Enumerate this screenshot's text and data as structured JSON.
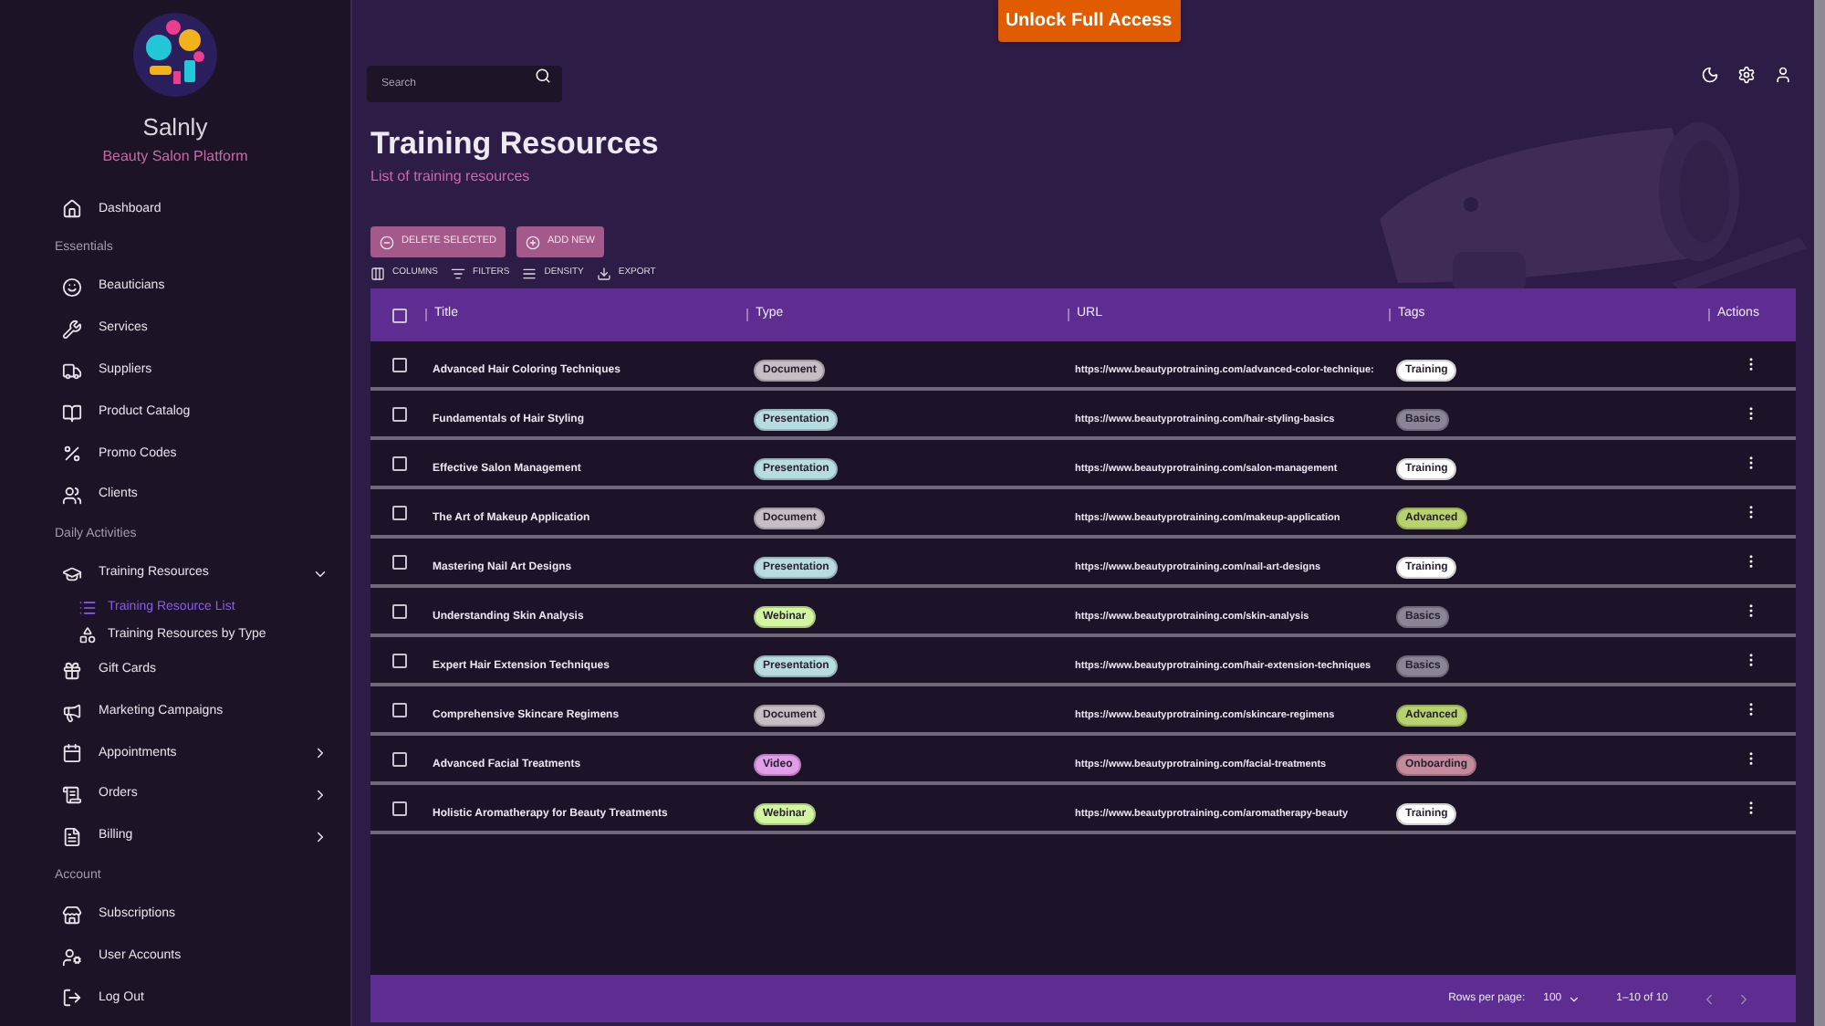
{
  "brand": {
    "name": "Salnly",
    "tagline": "Beauty Salon Platform"
  },
  "sidebar": {
    "sections": [
      {
        "items": [
          {
            "label": "Dashboard"
          }
        ]
      },
      {
        "heading": "Essentials",
        "items": [
          {
            "label": "Beauticians"
          },
          {
            "label": "Services"
          },
          {
            "label": "Suppliers"
          },
          {
            "label": "Product Catalog"
          },
          {
            "label": "Promo Codes"
          },
          {
            "label": "Clients"
          }
        ]
      },
      {
        "heading": "Daily Activities",
        "items": [
          {
            "label": "Training Resources",
            "expanded": true,
            "children": [
              {
                "label": "Training Resource List",
                "selected": true
              },
              {
                "label": "Training Resources by Type",
                "selected": false
              }
            ]
          },
          {
            "label": "Gift Cards"
          },
          {
            "label": "Marketing Campaigns"
          },
          {
            "label": "Appointments",
            "expanded": false
          },
          {
            "label": "Orders",
            "expanded": false
          },
          {
            "label": "Billing",
            "expanded": false
          }
        ]
      },
      {
        "heading": "Account",
        "items": [
          {
            "label": "Subscriptions"
          },
          {
            "label": "User Accounts"
          },
          {
            "label": "Log Out"
          }
        ]
      }
    ]
  },
  "banner": {
    "label": "Unlock Full Access"
  },
  "search": {
    "placeholder": "Search"
  },
  "page": {
    "title": "Training Resources",
    "subtitle": "List of training resources"
  },
  "actions": [
    "DELETE SELECTED",
    "ADD NEW"
  ],
  "toolbar": [
    "COLUMNS",
    "FILTERS",
    "DENSITY",
    "EXPORT"
  ],
  "table": {
    "header_checked": false,
    "columns": [
      "Title",
      "Type",
      "URL",
      "Tags",
      "Actions"
    ],
    "rows": [
      {
        "checked": false,
        "title": "Advanced Hair Coloring Techniques",
        "type": {
          "label": "Document",
          "color": "#c6bec4"
        },
        "url": "https://www.beautyprotraining.com/advanced-color-technique:",
        "tag": {
          "label": "Training",
          "color": "#ffffff"
        }
      },
      {
        "checked": false,
        "title": "Fundamentals of Hair Styling",
        "type": {
          "label": "Presentation",
          "color": "#b8dde0"
        },
        "url": "https://www.beautyprotraining.com/hair-styling-basics",
        "tag": {
          "label": "Basics",
          "color": "#8b8396"
        }
      },
      {
        "checked": false,
        "title": "Effective Salon Management",
        "type": {
          "label": "Presentation",
          "color": "#b8dde0"
        },
        "url": "https://www.beautyprotraining.com/salon-management",
        "tag": {
          "label": "Training",
          "color": "#ffffff"
        }
      },
      {
        "checked": false,
        "title": "The Art of Makeup Application",
        "type": {
          "label": "Document",
          "color": "#c6bec4"
        },
        "url": "https://www.beautyprotraining.com/makeup-application",
        "tag": {
          "label": "Advanced",
          "color": "#b7d36e"
        }
      },
      {
        "checked": false,
        "title": "Mastering Nail Art Designs",
        "type": {
          "label": "Presentation",
          "color": "#b8dde0"
        },
        "url": "https://www.beautyprotraining.com/nail-art-designs",
        "tag": {
          "label": "Training",
          "color": "#ffffff"
        }
      },
      {
        "checked": false,
        "title": "Understanding Skin Analysis",
        "type": {
          "label": "Webinar",
          "color": "#d3f7a0"
        },
        "url": "https://www.beautyprotraining.com/skin-analysis",
        "tag": {
          "label": "Basics",
          "color": "#8b8396"
        }
      },
      {
        "checked": false,
        "title": "Expert Hair Extension Techniques",
        "type": {
          "label": "Presentation",
          "color": "#b8dde0"
        },
        "url": "https://www.beautyprotraining.com/hair-extension-techniques",
        "tag": {
          "label": "Basics",
          "color": "#8b8396"
        }
      },
      {
        "checked": false,
        "title": "Comprehensive Skincare Regimens",
        "type": {
          "label": "Document",
          "color": "#c6bec4"
        },
        "url": "https://www.beautyprotraining.com/skincare-regimens",
        "tag": {
          "label": "Advanced",
          "color": "#b7d36e"
        }
      },
      {
        "checked": false,
        "title": "Advanced Facial Treatments",
        "type": {
          "label": "Video",
          "color": "#e29ee9"
        },
        "url": "https://www.beautyprotraining.com/facial-treatments",
        "tag": {
          "label": "Onboarding",
          "color": "#c48b9d"
        }
      },
      {
        "checked": false,
        "title": "Holistic Aromatherapy for Beauty Treatments",
        "type": {
          "label": "Webinar",
          "color": "#d3f7a0"
        },
        "url": "https://www.beautyprotraining.com/aromatherapy-beauty",
        "tag": {
          "label": "Training",
          "color": "#ffffff"
        }
      }
    ]
  },
  "pagination": {
    "rows_label": "Rows per page:",
    "rows_value": "100",
    "range": "1–10 of 10"
  }
}
